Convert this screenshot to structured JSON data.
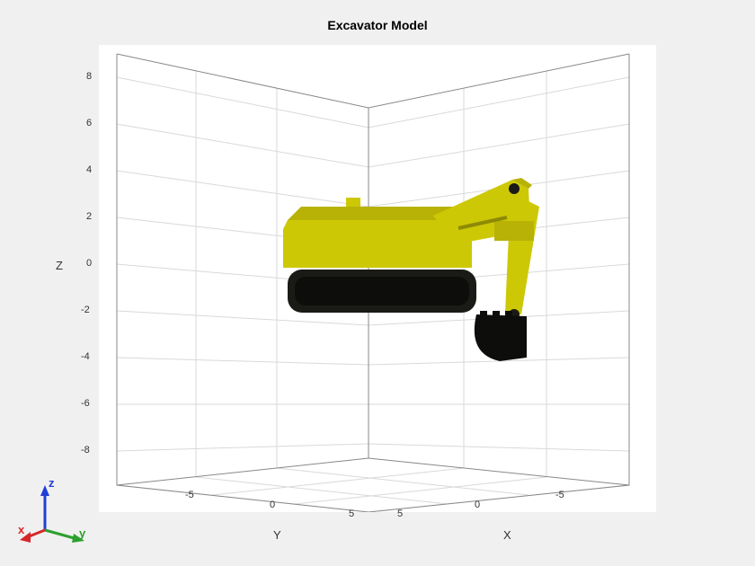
{
  "chart_data": {
    "type": "3d-model",
    "title": "Excavator Model",
    "xlabel": "X",
    "ylabel": "Y",
    "zlabel": "Z",
    "x_ticks": [
      -5,
      0,
      5
    ],
    "y_ticks": [
      -5,
      0,
      5
    ],
    "z_ticks": [
      -8,
      -6,
      -4,
      -2,
      0,
      2,
      4,
      6,
      8
    ],
    "xlim": [
      -8,
      8
    ],
    "ylim": [
      -8,
      8
    ],
    "zlim": [
      -9,
      9
    ],
    "model": "excavator",
    "colors": {
      "body": "#cdc806",
      "tracks": "#1a1a16",
      "bucket": "#0d0d0b"
    }
  },
  "triad": {
    "x_label": "x",
    "y_label": "y",
    "z_label": "z",
    "x_color": "#d62728",
    "y_color": "#2ca02c",
    "z_color": "#1f3fd6"
  },
  "bg": "#f0f0f0",
  "plot_bg": "#ffffff"
}
